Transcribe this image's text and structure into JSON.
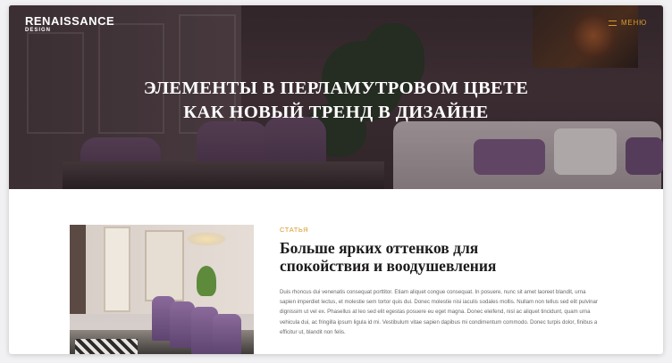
{
  "header": {
    "logo_main": "RENAISSANCE",
    "logo_sub": "DESIGN",
    "menu_label": "МЕНЮ",
    "menu_icon": "hamburger-icon",
    "accent_color": "#d99a2b"
  },
  "hero": {
    "title_line1": "ЭЛЕМЕНТЫ В ПЕРЛАМУТРОВОМ ЦВЕТЕ",
    "title_line2": "КАК НОВЫЙ ТРЕНД В ДИЗАЙНЕ"
  },
  "article": {
    "tag": "СТАТЬЯ",
    "title_line1": "Больше ярких оттенков для",
    "title_line2": "спокойствия и воодушевления",
    "body": "Duis rhoncus dui venenatis consequat porttitor. Etiam aliquet congue consequat. In posuere, nunc sit amet laoreet blandit, urna sapien imperdiet lectus, et molestie sem tortor quis dui. Donec molestie nisi iaculis sodales mollis. Nullam non tellus sed elit pulvinar dignissim ut vel ex. Phasellus at leo sed elit egestas posuere eu eget magna. Donec eleifend, nisl ac aliquet tincidunt, quam urna vehicula dui, ac fringilla ipsum ligula id mi. Vestibulum vitae sapien dapibus mi condimentum commodo. Donec turpis dolor, finibus a efficitur ut, blandit non felis."
  }
}
